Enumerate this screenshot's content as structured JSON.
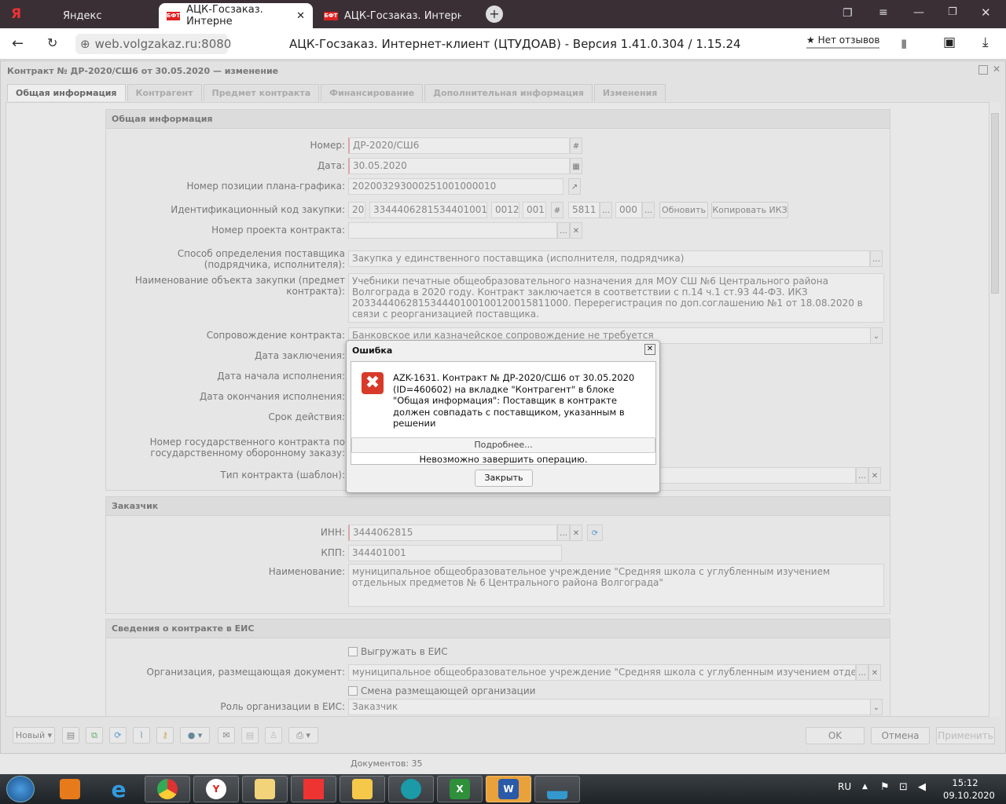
{
  "browser": {
    "tabs": [
      {
        "label": "Яндекс"
      },
      {
        "label": "АЦК-Госзаказ. Интерне"
      },
      {
        "label": "АЦК-Госзаказ. Интернет-к"
      }
    ],
    "url": "web.volgzakaz.ru:8080",
    "page_title": "АЦК-Госзаказ. Интернет-клиент (ЦТУДОАВ) - Версия 1.41.0.304 / 1.15.24",
    "reviews": "★ Нет отзывов",
    "logo": "Я"
  },
  "window": {
    "title": "Контракт № ДР-2020/СШ6 от 30.05.2020 — изменение",
    "tabs": [
      "Общая информация",
      "Контрагент",
      "Предмет контракта",
      "Финансирование",
      "Дополнительная информация",
      "Изменения"
    ]
  },
  "general": {
    "title": "Общая информация",
    "number_label": "Номер:",
    "number": "ДР-2020/СШ6",
    "date_label": "Дата:",
    "date": "30.05.2020",
    "plan_label": "Номер позиции плана-графика:",
    "plan": "202003293000251001000010",
    "ikz_label": "Идентификационный код закупки:",
    "ikz": [
      "20",
      "3344406281534401001",
      "0012",
      "001",
      "5811",
      "000"
    ],
    "refresh": "Обновить",
    "copy_ikz": "Копировать ИКЗ",
    "project_label": "Номер проекта контракта:",
    "project": "",
    "method_label": "Способ определения поставщика (подрядчика, исполнителя):",
    "method": "Закупка у единственного поставщика (исполнителя, подрядчика)",
    "object_label": "Наименование объекта закупки (предмет контракта):",
    "object": "Учебники печатные общеобразовательного назначения для МОУ СШ №6 Центрального района Волгограда в 2020 году. Контракт заключается в соответствии с п.14 ч.1 ст.93 44-ФЗ. ИКЗ 203344406281534440100100120015811000. Перерегистрация по доп.соглашению №1 от 18.08.2020 в связи с реорганизацией поставщика.",
    "support_label": "Сопровождение контракта:",
    "support": "Банковское или казначейское сопровождение не требуется",
    "conclusion_label": "Дата заключения:",
    "start_label": "Дата начала исполнения:",
    "end_label": "Дата окончания исполнения:",
    "term_label": "Срок действия:",
    "gov_label": "Номер государственного контракта по государственному оборонному заказу:",
    "type_label": "Тип контракта (шаблон):"
  },
  "customer": {
    "title": "Заказчик",
    "inn_label": "ИНН:",
    "inn": "3444062815",
    "kpp_label": "КПП:",
    "kpp": "344401001",
    "name_label": "Наименование:",
    "name": "муниципальное общеобразовательное учреждение \"Средняя школа с углубленным изучением отдельных предметов № 6 Центрального района Волгограда\""
  },
  "eis": {
    "title": "Сведения о контракте в ЕИС",
    "upload": "Выгружать в ЕИС",
    "org_label": "Организация, размещающая документ:",
    "org": "муниципальное общеобразовательное учреждение \"Средняя школа с углубленным изучением отдельных предметов",
    "change_org": "Смена размещающей организации",
    "role_label": "Роль организации в ЕИС:",
    "role": "Заказчик"
  },
  "toolbar": {
    "new": "Новый",
    "ok": "OK",
    "cancel": "Отмена",
    "apply": "Применить"
  },
  "status": {
    "documents": "Документов: 35"
  },
  "dialog": {
    "title": "Ошибка",
    "message": "AZK-1631. Контракт № ДР-2020/СШ6 от 30.05.2020 (ID=460602) на вкладке \"Контрагент\" в блоке \"Общая информация\": Поставщик в контракте должен совпадать с поставщиком, указанным в решении",
    "details": "Подробнее...",
    "summary": "Невозможно завершить операцию.",
    "close": "Закрыть"
  },
  "taskbar": {
    "lang": "RU",
    "time": "15:12",
    "date": "09.10.2020"
  }
}
